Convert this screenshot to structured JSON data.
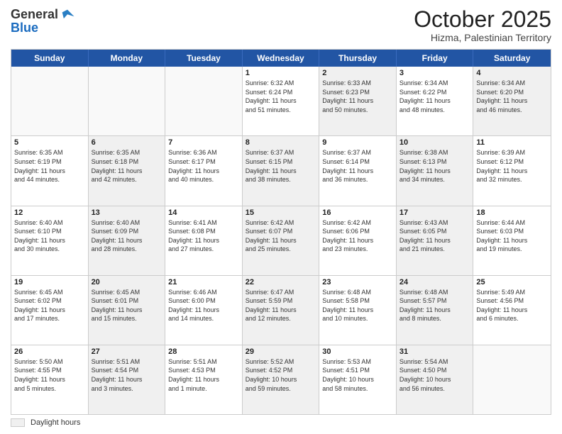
{
  "header": {
    "logo_general": "General",
    "logo_blue": "Blue",
    "month_title": "October 2025",
    "location": "Hizma, Palestinian Territory"
  },
  "weekdays": [
    "Sunday",
    "Monday",
    "Tuesday",
    "Wednesday",
    "Thursday",
    "Friday",
    "Saturday"
  ],
  "rows": [
    [
      {
        "day": "",
        "info": "",
        "shaded": false,
        "empty": true
      },
      {
        "day": "",
        "info": "",
        "shaded": false,
        "empty": true
      },
      {
        "day": "",
        "info": "",
        "shaded": false,
        "empty": true
      },
      {
        "day": "1",
        "info": "Sunrise: 6:32 AM\nSunset: 6:24 PM\nDaylight: 11 hours\nand 51 minutes.",
        "shaded": false,
        "empty": false
      },
      {
        "day": "2",
        "info": "Sunrise: 6:33 AM\nSunset: 6:23 PM\nDaylight: 11 hours\nand 50 minutes.",
        "shaded": true,
        "empty": false
      },
      {
        "day": "3",
        "info": "Sunrise: 6:34 AM\nSunset: 6:22 PM\nDaylight: 11 hours\nand 48 minutes.",
        "shaded": false,
        "empty": false
      },
      {
        "day": "4",
        "info": "Sunrise: 6:34 AM\nSunset: 6:20 PM\nDaylight: 11 hours\nand 46 minutes.",
        "shaded": true,
        "empty": false
      }
    ],
    [
      {
        "day": "5",
        "info": "Sunrise: 6:35 AM\nSunset: 6:19 PM\nDaylight: 11 hours\nand 44 minutes.",
        "shaded": false,
        "empty": false
      },
      {
        "day": "6",
        "info": "Sunrise: 6:35 AM\nSunset: 6:18 PM\nDaylight: 11 hours\nand 42 minutes.",
        "shaded": true,
        "empty": false
      },
      {
        "day": "7",
        "info": "Sunrise: 6:36 AM\nSunset: 6:17 PM\nDaylight: 11 hours\nand 40 minutes.",
        "shaded": false,
        "empty": false
      },
      {
        "day": "8",
        "info": "Sunrise: 6:37 AM\nSunset: 6:15 PM\nDaylight: 11 hours\nand 38 minutes.",
        "shaded": true,
        "empty": false
      },
      {
        "day": "9",
        "info": "Sunrise: 6:37 AM\nSunset: 6:14 PM\nDaylight: 11 hours\nand 36 minutes.",
        "shaded": false,
        "empty": false
      },
      {
        "day": "10",
        "info": "Sunrise: 6:38 AM\nSunset: 6:13 PM\nDaylight: 11 hours\nand 34 minutes.",
        "shaded": true,
        "empty": false
      },
      {
        "day": "11",
        "info": "Sunrise: 6:39 AM\nSunset: 6:12 PM\nDaylight: 11 hours\nand 32 minutes.",
        "shaded": false,
        "empty": false
      }
    ],
    [
      {
        "day": "12",
        "info": "Sunrise: 6:40 AM\nSunset: 6:10 PM\nDaylight: 11 hours\nand 30 minutes.",
        "shaded": false,
        "empty": false
      },
      {
        "day": "13",
        "info": "Sunrise: 6:40 AM\nSunset: 6:09 PM\nDaylight: 11 hours\nand 28 minutes.",
        "shaded": true,
        "empty": false
      },
      {
        "day": "14",
        "info": "Sunrise: 6:41 AM\nSunset: 6:08 PM\nDaylight: 11 hours\nand 27 minutes.",
        "shaded": false,
        "empty": false
      },
      {
        "day": "15",
        "info": "Sunrise: 6:42 AM\nSunset: 6:07 PM\nDaylight: 11 hours\nand 25 minutes.",
        "shaded": true,
        "empty": false
      },
      {
        "day": "16",
        "info": "Sunrise: 6:42 AM\nSunset: 6:06 PM\nDaylight: 11 hours\nand 23 minutes.",
        "shaded": false,
        "empty": false
      },
      {
        "day": "17",
        "info": "Sunrise: 6:43 AM\nSunset: 6:05 PM\nDaylight: 11 hours\nand 21 minutes.",
        "shaded": true,
        "empty": false
      },
      {
        "day": "18",
        "info": "Sunrise: 6:44 AM\nSunset: 6:03 PM\nDaylight: 11 hours\nand 19 minutes.",
        "shaded": false,
        "empty": false
      }
    ],
    [
      {
        "day": "19",
        "info": "Sunrise: 6:45 AM\nSunset: 6:02 PM\nDaylight: 11 hours\nand 17 minutes.",
        "shaded": false,
        "empty": false
      },
      {
        "day": "20",
        "info": "Sunrise: 6:45 AM\nSunset: 6:01 PM\nDaylight: 11 hours\nand 15 minutes.",
        "shaded": true,
        "empty": false
      },
      {
        "day": "21",
        "info": "Sunrise: 6:46 AM\nSunset: 6:00 PM\nDaylight: 11 hours\nand 14 minutes.",
        "shaded": false,
        "empty": false
      },
      {
        "day": "22",
        "info": "Sunrise: 6:47 AM\nSunset: 5:59 PM\nDaylight: 11 hours\nand 12 minutes.",
        "shaded": true,
        "empty": false
      },
      {
        "day": "23",
        "info": "Sunrise: 6:48 AM\nSunset: 5:58 PM\nDaylight: 11 hours\nand 10 minutes.",
        "shaded": false,
        "empty": false
      },
      {
        "day": "24",
        "info": "Sunrise: 6:48 AM\nSunset: 5:57 PM\nDaylight: 11 hours\nand 8 minutes.",
        "shaded": true,
        "empty": false
      },
      {
        "day": "25",
        "info": "Sunrise: 5:49 AM\nSunset: 4:56 PM\nDaylight: 11 hours\nand 6 minutes.",
        "shaded": false,
        "empty": false
      }
    ],
    [
      {
        "day": "26",
        "info": "Sunrise: 5:50 AM\nSunset: 4:55 PM\nDaylight: 11 hours\nand 5 minutes.",
        "shaded": false,
        "empty": false
      },
      {
        "day": "27",
        "info": "Sunrise: 5:51 AM\nSunset: 4:54 PM\nDaylight: 11 hours\nand 3 minutes.",
        "shaded": true,
        "empty": false
      },
      {
        "day": "28",
        "info": "Sunrise: 5:51 AM\nSunset: 4:53 PM\nDaylight: 11 hours\nand 1 minute.",
        "shaded": false,
        "empty": false
      },
      {
        "day": "29",
        "info": "Sunrise: 5:52 AM\nSunset: 4:52 PM\nDaylight: 10 hours\nand 59 minutes.",
        "shaded": true,
        "empty": false
      },
      {
        "day": "30",
        "info": "Sunrise: 5:53 AM\nSunset: 4:51 PM\nDaylight: 10 hours\nand 58 minutes.",
        "shaded": false,
        "empty": false
      },
      {
        "day": "31",
        "info": "Sunrise: 5:54 AM\nSunset: 4:50 PM\nDaylight: 10 hours\nand 56 minutes.",
        "shaded": true,
        "empty": false
      },
      {
        "day": "",
        "info": "",
        "shaded": false,
        "empty": true
      }
    ]
  ],
  "legend": {
    "daylight_label": "Daylight hours"
  }
}
